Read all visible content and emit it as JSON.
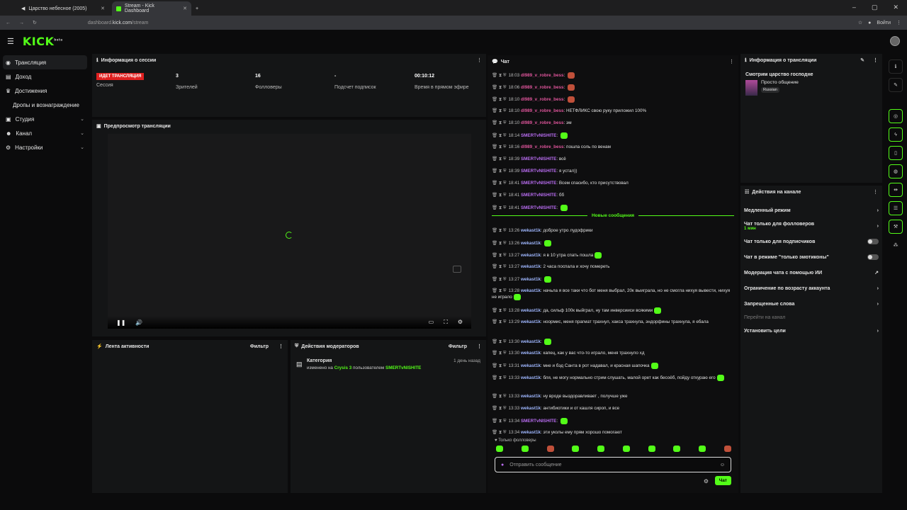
{
  "browser": {
    "tabs": [
      {
        "label": "Царство небесное (2005)"
      },
      {
        "label": "Stream - Kick Dashboard"
      }
    ],
    "url_prefix": "dashboard.",
    "url_host": "kick.com",
    "url_path": "/stream",
    "signin": "Войти"
  },
  "nav": {
    "logo": "KICK",
    "logo_badge": "beta",
    "items": [
      {
        "label": "Трансляция"
      },
      {
        "label": "Доход"
      },
      {
        "label": "Достижения"
      },
      {
        "label": "Дропы и вознаграждение"
      },
      {
        "label": "Студия"
      },
      {
        "label": "Канал"
      },
      {
        "label": "Настройки"
      }
    ]
  },
  "session": {
    "title": "Информация о сессии",
    "live_badge": "ИДЕТ ТРАНСЛЯЦИЯ",
    "live_label": "Сессия",
    "stats": [
      {
        "value": "3",
        "label": "Зрителей"
      },
      {
        "value": "16",
        "label": "Фолловеры"
      },
      {
        "value": "-",
        "label": "Подсчет подписок"
      },
      {
        "value": "00:10:12",
        "label": "Время в прямом эфире"
      }
    ]
  },
  "preview": {
    "title": "Предпросмотр трансляции"
  },
  "activity": {
    "title": "Лента активности",
    "filter": "Фильтр"
  },
  "modactions": {
    "title": "Действия модераторов",
    "filter": "Фильтр",
    "item": {
      "title": "Категория",
      "time": "1 день назад",
      "pre": "изменено на",
      "category": "Crysis 3",
      "mid": "пользователем",
      "user": "SMERTvNISHITE"
    }
  },
  "chat": {
    "title": "Чат",
    "new_messages": "Новые сообщения",
    "followers_only": "Только фолловеры",
    "input_placeholder": "Отправить сообщение",
    "send": "Чат",
    "messages": [
      {
        "time": "18:03",
        "user": "dl989_v_robre_bess",
        "text": "",
        "emoji": true
      },
      {
        "time": "18:06",
        "user": "dl989_v_robre_bess",
        "text": "",
        "emoji": true
      },
      {
        "time": "18:10",
        "user": "dl989_v_robre_bess",
        "text": "",
        "emoji": true
      },
      {
        "time": "18:10",
        "user": "dl989_v_robre_bess",
        "text": "НЕТФЛИКС свою руку приложил 100%",
        "emoji": false
      },
      {
        "time": "18:10",
        "user": "dl989_v_robre_bess",
        "text": "эм",
        "emoji": false
      },
      {
        "time": "18:14",
        "user": "SMERTvNISHITE",
        "text": "",
        "emoji": true
      },
      {
        "time": "18:16",
        "user": "dl989_v_robre_bess",
        "text": "пошла соль по венам",
        "emoji": false
      },
      {
        "time": "18:39",
        "user": "SMERTvNISHITE",
        "text": "всё",
        "emoji": false
      },
      {
        "time": "18:39",
        "user": "SMERTvNISHITE",
        "text": "я устал))",
        "emoji": false
      },
      {
        "time": "18:41",
        "user": "SMERTvNISHITE",
        "text": "Всем спасибо, кто присутствовал",
        "emoji": false
      },
      {
        "time": "18:41",
        "user": "SMERTvNISHITE",
        "text": "бб",
        "emoji": false
      },
      {
        "time": "18:41",
        "user": "SMERTvNISHITE",
        "text": "",
        "emoji": true
      },
      {
        "time": "13:26",
        "user": "wekast1k",
        "text": "доброе утро лудофрики",
        "emoji": false
      },
      {
        "time": "13:26",
        "user": "wekast1k",
        "text": "",
        "emoji": true
      },
      {
        "time": "13:27",
        "user": "wekast1k",
        "text": "я в 10 утра спать пошла",
        "emoji": true
      },
      {
        "time": "13:27",
        "user": "wekast1k",
        "text": "2 часа поспала и хочу помереть",
        "emoji": false
      },
      {
        "time": "13:27",
        "user": "wekast1k",
        "text": "",
        "emoji": true
      },
      {
        "time": "13:28",
        "user": "wekast1k",
        "text": "начьла я все таки что бот меня выбрал, 20к выиграла, но не смогла нихуя вывести, нихуя не играло",
        "emoji": true
      },
      {
        "time": "13:28",
        "user": "wekast1k",
        "text": "да, сильф 100к выйграл, ну там инверсииси всякими",
        "emoji": true
      },
      {
        "time": "13:29",
        "user": "wekast1k",
        "text": "ноормис, меня прагмат трахнул, хакса трахнула, эндорфины трахнула, я ебала",
        "emoji": false
      },
      {
        "time": "13:30",
        "user": "wekast1k",
        "text": "",
        "emoji": true
      },
      {
        "time": "13:30",
        "user": "wekast1k",
        "text": "капец, как у вас что-то играло, меня трахнуло хд",
        "emoji": false
      },
      {
        "time": "13:31",
        "user": "wekast1k",
        "text": "мне и бэд Санта в рот надавал, и красная шапочка",
        "emoji": true
      },
      {
        "time": "13:33",
        "user": "wekast1k",
        "text": "бля, не могу нормально стрим слушать, малой орет как бесоёб, пойду откураю его",
        "emoji": true
      },
      {
        "time": "13:33",
        "user": "wekast1k",
        "text": "ну вроде выздоравливает , получше уже",
        "emoji": false
      },
      {
        "time": "13:33",
        "user": "wekast1k",
        "text": "антибиотики и от кашля сироп, и все",
        "emoji": false
      },
      {
        "time": "13:34",
        "user": "SMERTvNISHITE",
        "text": "",
        "emoji": true
      },
      {
        "time": "13:34",
        "user": "wekast1k",
        "text": "эти уколы ему прям хорошо помогают",
        "emoji": false
      }
    ],
    "colors": {
      "dl": "#e0559c",
      "smert": "#b86cf0",
      "wekast": "#9fb7ff"
    }
  },
  "stream_info": {
    "title": "Информация о трансляции",
    "stream_title": "Смотрим царство господне",
    "category": "Просто общение",
    "tag": "Russian"
  },
  "channel_actions": {
    "title": "Действия на канале",
    "rows": [
      {
        "label": "Медленный режим"
      },
      {
        "label": "Чат только для фолловеров",
        "sub": "1 мин"
      },
      {
        "label": "Чат только для подписчиков"
      },
      {
        "label": "Чат в режиме \"только эмотиконы\""
      },
      {
        "label": "Модерация чата с помощью ИИ"
      },
      {
        "label": "Ограничение по возрасту аккаунта"
      },
      {
        "label": "Запрещенные слова"
      },
      {
        "label": "Перейти на канал"
      },
      {
        "label": "Установить цели"
      }
    ]
  }
}
